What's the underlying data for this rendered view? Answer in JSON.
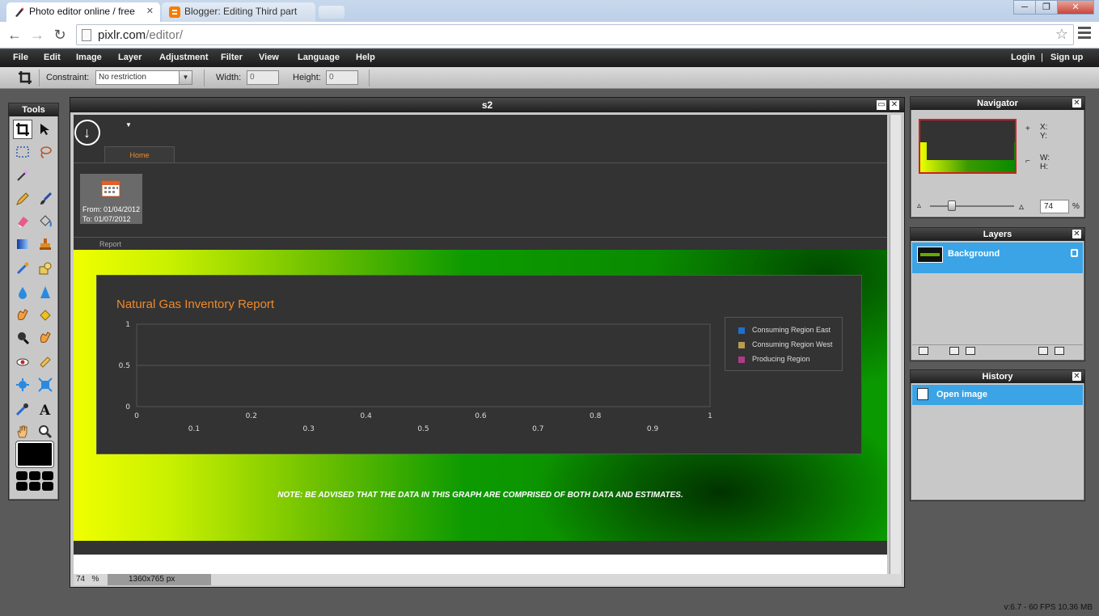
{
  "browser": {
    "tabs": [
      {
        "title": "Photo editor online / free",
        "active": true
      },
      {
        "title": "Blogger: Editing Third part",
        "active": false
      }
    ],
    "url_host": "pixlr.com",
    "url_path": "/editor/",
    "window_buttons": {
      "minimize": "─",
      "maximize": "❐",
      "close": "✕"
    }
  },
  "menu": {
    "items": [
      "File",
      "Edit",
      "Image",
      "Layer",
      "Adjustment",
      "Filter",
      "View",
      "Language",
      "Help"
    ],
    "login": "Login",
    "separator": "|",
    "signup": "Sign up"
  },
  "options": {
    "constraint_label": "Constraint:",
    "constraint_value": "No restriction",
    "width_label": "Width:",
    "width_value": "0",
    "height_label": "Height:",
    "height_value": "0"
  },
  "tools_panel": {
    "title": "Tools"
  },
  "document": {
    "title": "s2",
    "zoom": "74",
    "zoom_unit": "%",
    "dimensions": "1360x765 px",
    "content": {
      "ribbon_tab": "Home",
      "date_from": "From: 01/04/2012",
      "date_to": "To: 01/07/2012",
      "report_label": "Report",
      "note": "NOTE: BE ADVISED THAT THE DATA IN THIS GRAPH ARE COMPRISED OF BOTH DATA AND ESTIMATES."
    }
  },
  "chart_data": {
    "type": "line",
    "title": "Natural Gas Inventory Report",
    "xlabel": "",
    "ylabel": "",
    "x_ticks_top": [
      "0",
      "0.2",
      "0.4",
      "0.6",
      "0.8",
      "1"
    ],
    "x_ticks_bottom": [
      "0.1",
      "0.3",
      "0.5",
      "0.7",
      "0.9"
    ],
    "y_ticks": [
      "1",
      "0.5",
      "0"
    ],
    "xlim": [
      0,
      1
    ],
    "ylim": [
      0,
      1
    ],
    "grid": true,
    "legend_position": "right",
    "series": [
      {
        "name": "Consuming Region East",
        "color": "#1e6fd0",
        "values": []
      },
      {
        "name": "Consuming Region West",
        "color": "#b89a50",
        "values": []
      },
      {
        "name": "Producing Region",
        "color": "#b03a8a",
        "values": []
      }
    ]
  },
  "navigator": {
    "title": "Navigator",
    "x_label": "X:",
    "y_label": "Y:",
    "w_label": "W:",
    "h_label": "H:",
    "zoom_value": "74",
    "zoom_unit": "%"
  },
  "layers": {
    "title": "Layers",
    "items": [
      {
        "name": "Background"
      }
    ]
  },
  "history": {
    "title": "History",
    "items": [
      {
        "label": "Open image"
      }
    ]
  },
  "status": {
    "version": "v:6.7 - 60 FPS 10.36 MB"
  },
  "colors": {
    "accent_blue": "#3aa4e6",
    "chart_title_orange": "#f08a2a",
    "background_green": "#0a8c00",
    "background_yellow": "#f0ff00"
  }
}
